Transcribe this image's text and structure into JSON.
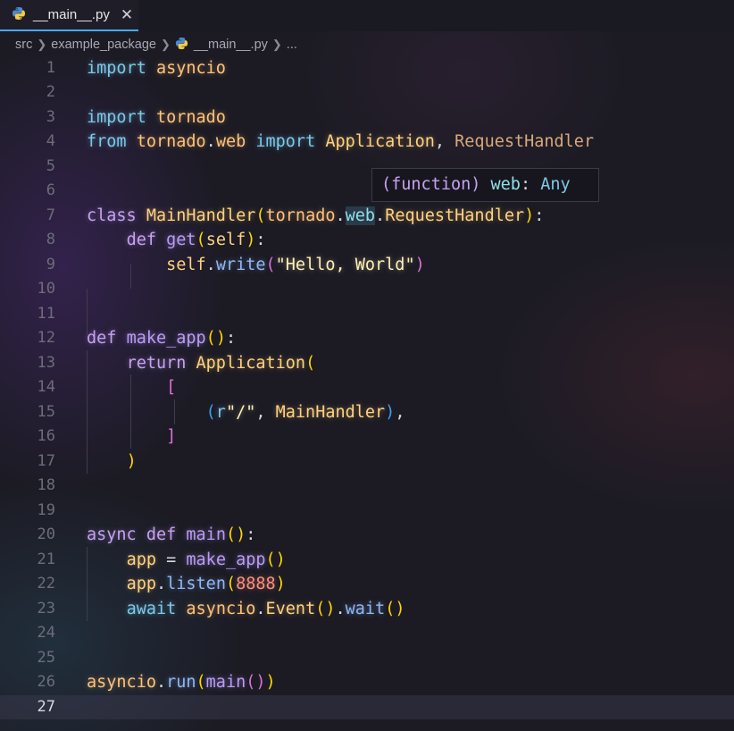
{
  "tab": {
    "label": "__main__.py",
    "close": "✕"
  },
  "breadcrumb": {
    "items": [
      "src",
      "example_package",
      "__main__.py",
      "..."
    ]
  },
  "tooltip": {
    "kind": "(function)",
    "name": "web",
    "sep": ": ",
    "type": "Any"
  },
  "editor": {
    "current_line": 27,
    "lines": [
      {
        "n": "1",
        "tokens": [
          [
            "import",
            "tok-kw"
          ],
          [
            " ",
            "tok-p"
          ],
          [
            "asyncio",
            "tok-mod"
          ]
        ]
      },
      {
        "n": "2",
        "tokens": []
      },
      {
        "n": "3",
        "tokens": [
          [
            "import",
            "tok-kw"
          ],
          [
            " ",
            "tok-p"
          ],
          [
            "tornado",
            "tok-mod"
          ]
        ]
      },
      {
        "n": "4",
        "tokens": [
          [
            "from",
            "tok-kw"
          ],
          [
            " ",
            "tok-p"
          ],
          [
            "tornado",
            "tok-mod"
          ],
          [
            ".",
            "tok-p"
          ],
          [
            "web",
            "tok-mod"
          ],
          [
            " ",
            "tok-p"
          ],
          [
            "import",
            "tok-kw"
          ],
          [
            " ",
            "tok-p"
          ],
          [
            "Application",
            "tok-cls"
          ],
          [
            ", ",
            "tok-p"
          ],
          [
            "RequestHandler",
            "tok-cls2"
          ]
        ]
      },
      {
        "n": "5",
        "tokens": []
      },
      {
        "n": "6",
        "tokens": []
      },
      {
        "n": "7",
        "tokens": [
          [
            "class",
            "tok-kw2"
          ],
          [
            " ",
            "tok-p"
          ],
          [
            "MainHandler",
            "tok-cls"
          ],
          [
            "(",
            "tok-b1"
          ],
          [
            "tornado",
            "tok-mod"
          ],
          [
            ".",
            "tok-p"
          ],
          [
            "web",
            "tok-hl"
          ],
          [
            ".",
            "tok-p"
          ],
          [
            "RequestHandler",
            "tok-cls"
          ],
          [
            ")",
            "tok-b1"
          ],
          [
            ":",
            "tok-p"
          ]
        ]
      },
      {
        "n": "8",
        "tokens": [
          [
            "    ",
            "tok-p"
          ],
          [
            "def",
            "tok-kw2"
          ],
          [
            " ",
            "tok-p"
          ],
          [
            "get",
            "tok-fn"
          ],
          [
            "(",
            "tok-b1"
          ],
          [
            "self",
            "tok-self"
          ],
          [
            ")",
            "tok-b1"
          ],
          [
            ":",
            "tok-p"
          ]
        ]
      },
      {
        "n": "9",
        "tokens": [
          [
            "        ",
            "tok-p"
          ],
          [
            "self",
            "tok-self"
          ],
          [
            ".",
            "tok-p"
          ],
          [
            "write",
            "tok-fn2"
          ],
          [
            "(",
            "tok-b2"
          ],
          [
            "\"Hello, World\"",
            "tok-str"
          ],
          [
            ")",
            "tok-b2"
          ]
        ]
      },
      {
        "n": "10",
        "tokens": []
      },
      {
        "n": "11",
        "tokens": []
      },
      {
        "n": "12",
        "tokens": [
          [
            "def",
            "tok-kw2"
          ],
          [
            " ",
            "tok-p"
          ],
          [
            "make_app",
            "tok-fn"
          ],
          [
            "(",
            "tok-b1"
          ],
          [
            ")",
            "tok-b1"
          ],
          [
            ":",
            "tok-p"
          ]
        ]
      },
      {
        "n": "13",
        "tokens": [
          [
            "    ",
            "tok-p"
          ],
          [
            "return",
            "tok-kw2"
          ],
          [
            " ",
            "tok-p"
          ],
          [
            "Application",
            "tok-cls"
          ],
          [
            "(",
            "tok-b1"
          ]
        ]
      },
      {
        "n": "14",
        "tokens": [
          [
            "        ",
            "tok-p"
          ],
          [
            "[",
            "tok-b2"
          ]
        ]
      },
      {
        "n": "15",
        "tokens": [
          [
            "            ",
            "tok-p"
          ],
          [
            "(",
            "tok-b3"
          ],
          [
            "r",
            "tok-kw"
          ],
          [
            "\"/\"",
            "tok-str"
          ],
          [
            ", ",
            "tok-p"
          ],
          [
            "MainHandler",
            "tok-cls"
          ],
          [
            ")",
            "tok-b3"
          ],
          [
            ",",
            "tok-p"
          ]
        ]
      },
      {
        "n": "16",
        "tokens": [
          [
            "        ",
            "tok-p"
          ],
          [
            "]",
            "tok-b2"
          ]
        ]
      },
      {
        "n": "17",
        "tokens": [
          [
            "    ",
            "tok-p"
          ],
          [
            ")",
            "tok-b1"
          ]
        ]
      },
      {
        "n": "18",
        "tokens": []
      },
      {
        "n": "19",
        "tokens": []
      },
      {
        "n": "20",
        "tokens": [
          [
            "async",
            "tok-kw2"
          ],
          [
            " ",
            "tok-p"
          ],
          [
            "def",
            "tok-kw2"
          ],
          [
            " ",
            "tok-p"
          ],
          [
            "main",
            "tok-fn"
          ],
          [
            "(",
            "tok-b1"
          ],
          [
            ")",
            "tok-b1"
          ],
          [
            ":",
            "tok-p"
          ]
        ]
      },
      {
        "n": "21",
        "tokens": [
          [
            "    ",
            "tok-p"
          ],
          [
            "app",
            "tok-var"
          ],
          [
            " = ",
            "tok-p"
          ],
          [
            "make_app",
            "tok-fn"
          ],
          [
            "(",
            "tok-b1"
          ],
          [
            ")",
            "tok-b1"
          ]
        ]
      },
      {
        "n": "22",
        "tokens": [
          [
            "    ",
            "tok-p"
          ],
          [
            "app",
            "tok-var"
          ],
          [
            ".",
            "tok-p"
          ],
          [
            "listen",
            "tok-fn2"
          ],
          [
            "(",
            "tok-b1"
          ],
          [
            "8888",
            "tok-num"
          ],
          [
            ")",
            "tok-b1"
          ]
        ]
      },
      {
        "n": "23",
        "tokens": [
          [
            "    ",
            "tok-p"
          ],
          [
            "await",
            "tok-kw"
          ],
          [
            " ",
            "tok-p"
          ],
          [
            "asyncio",
            "tok-mod"
          ],
          [
            ".",
            "tok-p"
          ],
          [
            "Event",
            "tok-cls"
          ],
          [
            "(",
            "tok-b1"
          ],
          [
            ")",
            "tok-b1"
          ],
          [
            ".",
            "tok-p"
          ],
          [
            "wait",
            "tok-fn2"
          ],
          [
            "(",
            "tok-b1"
          ],
          [
            ")",
            "tok-b1"
          ]
        ]
      },
      {
        "n": "24",
        "tokens": []
      },
      {
        "n": "25",
        "tokens": []
      },
      {
        "n": "26",
        "tokens": [
          [
            "asyncio",
            "tok-mod"
          ],
          [
            ".",
            "tok-p"
          ],
          [
            "run",
            "tok-fn2"
          ],
          [
            "(",
            "tok-b1"
          ],
          [
            "main",
            "tok-fn"
          ],
          [
            "(",
            "tok-b2"
          ],
          [
            ")",
            "tok-b2"
          ],
          [
            ")",
            "tok-b1"
          ]
        ]
      },
      {
        "n": "27",
        "tokens": []
      }
    ]
  }
}
